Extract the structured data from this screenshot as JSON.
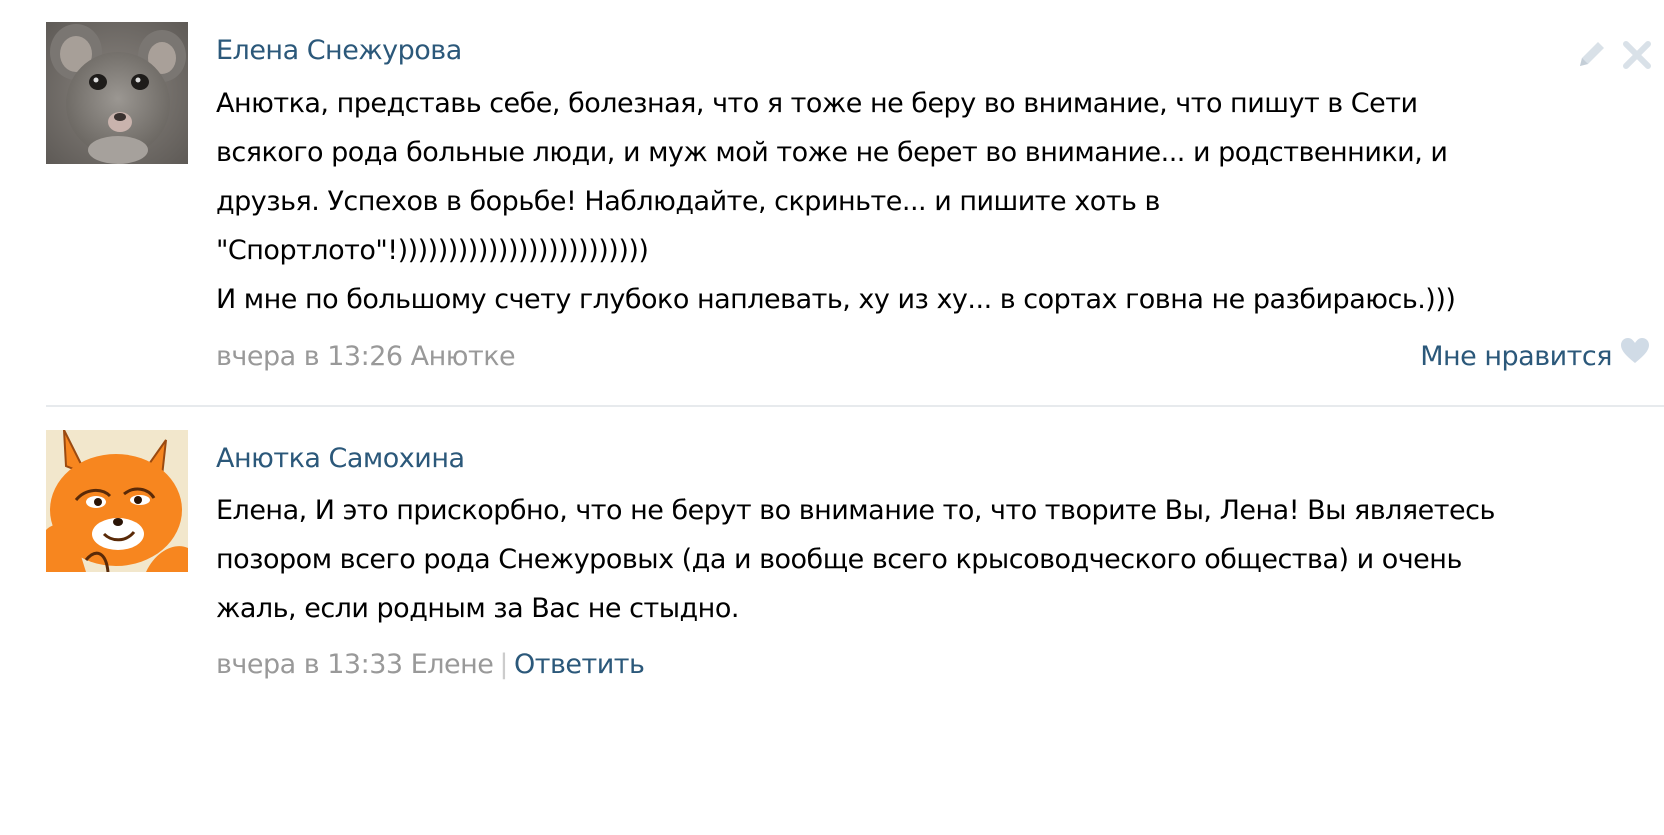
{
  "comments": [
    {
      "author": "Елена Снежурова",
      "text_lines": [
        "Анютка, представь себе, болезная, что я тоже не беру во внимание, что пишут в Сети",
        "всякого рода больные люди, и муж мой тоже не берет во внимание... и родственники, и",
        "друзья. Успехов в борьбе! Наблюдайте, скриньте... и пишите хоть в",
        "\"Спортлото\"!)))))))))))))))))))))))))",
        "И мне по большому счету глубоко наплевать, ху из ху... в сортах говна не разбираюсь.)))"
      ],
      "date": "вчера в 13:26",
      "to": "Анютке",
      "like_label": "Мне нравится",
      "avatar_icon": "rat-avatar"
    },
    {
      "author": "Анютка Самохина",
      "text_lines": [
        "Елена, И это прискорбно, что не берут во внимание то, что творите Вы, Лена! Вы являетесь",
        "позором всего рода Снежуровых (да и вообще всего крысоводческого общества) и очень",
        "жаль, если родным за Вас не стыдно."
      ],
      "date": "вчера в 13:33",
      "to": "Елене",
      "separator": "|",
      "reply_label": "Ответить",
      "avatar_icon": "fox-avatar"
    }
  ],
  "colors": {
    "link": "#2b587a",
    "meta": "#999999",
    "divider": "#e7eaed",
    "heart": "#d0dbe6"
  },
  "icons": [
    "edit-icon",
    "close-icon",
    "heart-icon"
  ]
}
